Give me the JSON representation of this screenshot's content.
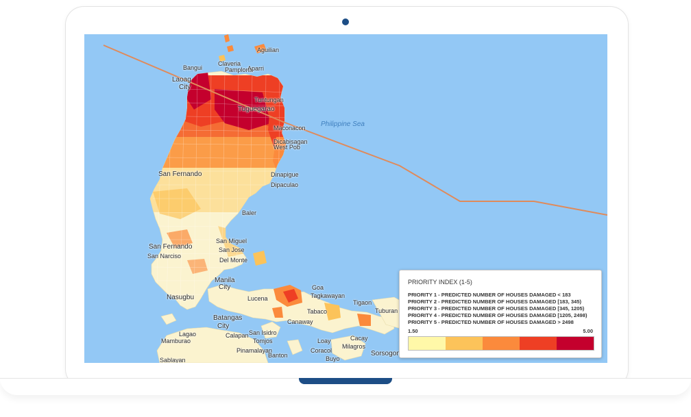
{
  "map": {
    "sea_label": "Philippine Sea",
    "places": [
      {
        "id": "aguilian",
        "name": "Aguilian"
      },
      {
        "id": "claveria",
        "name": "Claveria"
      },
      {
        "id": "bangui",
        "name": "Bangui"
      },
      {
        "id": "pamplona",
        "name": "Pamplona"
      },
      {
        "id": "aparri",
        "name": "Aparri"
      },
      {
        "id": "laoag",
        "name": "Laoag"
      },
      {
        "id": "city1",
        "name": "City"
      },
      {
        "id": "tuntungan",
        "name": "Tuntungan"
      },
      {
        "id": "tuguegarao",
        "name": "Tuguegarao"
      },
      {
        "id": "maconacon",
        "name": "Maconacon"
      },
      {
        "id": "dicabisagan",
        "name": "Dicabisagan"
      },
      {
        "id": "westpob",
        "name": "West Pob"
      },
      {
        "id": "sanfernando1",
        "name": "San Fernando"
      },
      {
        "id": "dinapigue",
        "name": "Dinapigue"
      },
      {
        "id": "dipaculao",
        "name": "Dipaculao"
      },
      {
        "id": "baler",
        "name": "Baler"
      },
      {
        "id": "sanmiguel",
        "name": "San Miguel"
      },
      {
        "id": "sanjose",
        "name": "San Jose"
      },
      {
        "id": "sanfernando2",
        "name": "San Fernando"
      },
      {
        "id": "sannarciso",
        "name": "San Narciso"
      },
      {
        "id": "delmonte",
        "name": "Del Monte"
      },
      {
        "id": "manila",
        "name": "Manila"
      },
      {
        "id": "city2",
        "name": "City"
      },
      {
        "id": "nasugbu",
        "name": "Nasugbu"
      },
      {
        "id": "lucena",
        "name": "Lucena"
      },
      {
        "id": "goa",
        "name": "Goa"
      },
      {
        "id": "tagkawayan",
        "name": "Tagkawayan"
      },
      {
        "id": "batangas",
        "name": "Batangas"
      },
      {
        "id": "city3",
        "name": "City"
      },
      {
        "id": "canaway",
        "name": "Canaway"
      },
      {
        "id": "tabaco",
        "name": "Tabaco"
      },
      {
        "id": "tabaco2",
        "name": "Tuburan"
      },
      {
        "id": "calapan",
        "name": "Calapan"
      },
      {
        "id": "sanisidro",
        "name": "San Isidro"
      },
      {
        "id": "tomjos",
        "name": "Tomjos"
      },
      {
        "id": "mamburao",
        "name": "Mamburao"
      },
      {
        "id": "lagao",
        "name": "Lagao"
      },
      {
        "id": "pinamalayan",
        "name": "Pinamalayan"
      },
      {
        "id": "sorsogon",
        "name": "Sorsogon"
      },
      {
        "id": "bantou",
        "name": "Banton"
      },
      {
        "id": "buyo",
        "name": "Buyo"
      },
      {
        "id": "sablayan",
        "name": "Sablayan"
      },
      {
        "id": "caracol",
        "name": "Coracol"
      },
      {
        "id": "ebo",
        "name": "Cacay"
      },
      {
        "id": "loay",
        "name": "Loay"
      },
      {
        "id": "milagros",
        "name": "Milagros"
      },
      {
        "id": "tigaon",
        "name": "Tigaon"
      }
    ]
  },
  "legend": {
    "title": "PRIORITY INDEX (1-5)",
    "lines": [
      "PRIORITY 1 - PREDICTED NUMBER OF HOUSES DAMAGED < 183",
      "PRIORITY 2 - PREDICTED NUMBER OF HOUSES DAMAGED [183, 345)",
      "PRIORITY 3 - PREDICTED NUMBER OF HOUSES DAMAGED [345, 1205)",
      "PRIORITY 4 - PREDICTED NUMBER OF HOUSES DAMAGED [1205, 2498)",
      "PRIORITY 5 - PREDICTED NUMBER OF HOUSES DAMAGED > 2498"
    ],
    "min": "1.50",
    "max": "5.00",
    "colors": [
      "#fff8a8",
      "#fcc35a",
      "#fb8a3c",
      "#ee3f24",
      "#c4002d"
    ]
  },
  "colors": {
    "sea": "#93c8f5",
    "land": "#fbf3cf",
    "track": "#e08a5a",
    "device_accent": "#1d4e86"
  }
}
